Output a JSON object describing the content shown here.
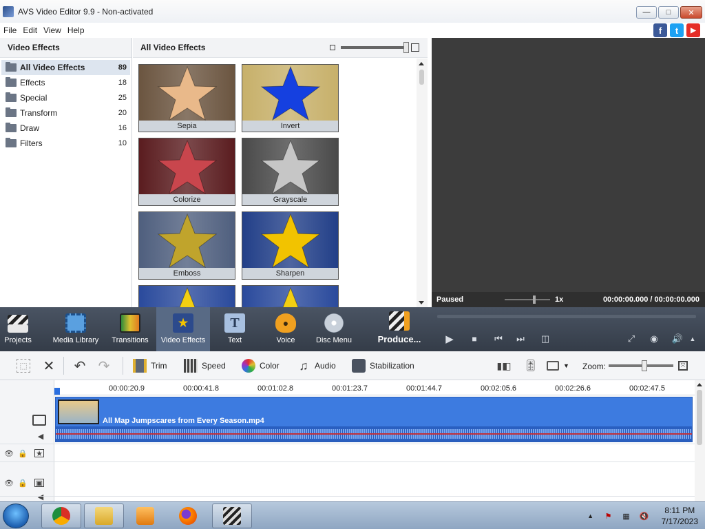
{
  "window": {
    "title": "AVS Video Editor 9.9 - Non-activated",
    "min_glyph": "—",
    "max_glyph": "□",
    "close_glyph": "✕"
  },
  "menu": [
    "File",
    "Edit",
    "View",
    "Help"
  ],
  "social": [
    {
      "name": "facebook",
      "glyph": "f",
      "color": "#3b5998"
    },
    {
      "name": "twitter",
      "glyph": "t",
      "color": "#1da1f2"
    },
    {
      "name": "youtube",
      "glyph": "▶",
      "color": "#e52d27"
    }
  ],
  "categories_panel": {
    "title": "Video Effects",
    "items": [
      {
        "label": "All Video Effects",
        "count": "89",
        "active": true
      },
      {
        "label": "Effects",
        "count": "18"
      },
      {
        "label": "Special",
        "count": "25"
      },
      {
        "label": "Transform",
        "count": "20"
      },
      {
        "label": "Draw",
        "count": "16"
      },
      {
        "label": "Filters",
        "count": "10"
      }
    ]
  },
  "effects_panel": {
    "title": "All Video Effects",
    "tiles": [
      {
        "label": "Sepia",
        "bg": "#6b5540",
        "star": "#e9b98a"
      },
      {
        "label": "Invert",
        "bg": "#c7b06a",
        "star": "#1540e0"
      },
      {
        "label": "Colorize",
        "bg": "#5a1c1f",
        "star": "#c9464d"
      },
      {
        "label": "Grayscale",
        "bg": "#4a4a4a",
        "star": "#c6c6c6"
      },
      {
        "label": "Emboss",
        "bg": "#4f5f7e",
        "star": "#c0a42c"
      },
      {
        "label": "Sharpen",
        "bg": "#223f88",
        "star": "#f2c300"
      },
      {
        "label": "",
        "bg": "#2a4a9c",
        "star": "#f3cf12"
      },
      {
        "label": "",
        "bg": "#2a4a9c",
        "star": "#f3cf12"
      }
    ]
  },
  "preview": {
    "status": "Paused",
    "speed": "1x",
    "time": "00:00:00.000 / 00:00:00.000"
  },
  "toolbar": [
    {
      "label": "Projects",
      "icon": "clapper-icon",
      "color": "#e8e8e8"
    },
    {
      "label": "Media Library",
      "icon": "film-icon",
      "color": "#5aa0e0"
    },
    {
      "label": "Transitions",
      "icon": "transition-icon",
      "color": "#e0b030"
    },
    {
      "label": "Video Effects",
      "icon": "star-icon",
      "color": "#2c4a8c",
      "active": true
    },
    {
      "label": "Text",
      "icon": "text-icon",
      "color": "#a8c0e0"
    },
    {
      "label": "Voice",
      "icon": "microphone-icon",
      "color": "#f0a020"
    },
    {
      "label": "Disc Menu",
      "icon": "disc-icon",
      "color": "#c8d0da"
    },
    {
      "label": "Produce...",
      "icon": "produce-icon",
      "color": "#e8e8e8"
    }
  ],
  "edit_toolbar": {
    "trim": "Trim",
    "speed": "Speed",
    "color": "Color",
    "audio": "Audio",
    "stabilization": "Stabilization",
    "zoom": "Zoom:"
  },
  "timeline": {
    "ticks": [
      "00:00:20.9",
      "00:00:41.8",
      "00:01:02.8",
      "00:01:23.7",
      "00:01:44.7",
      "00:02:05.6",
      "00:02:26.6",
      "00:02:47.5"
    ],
    "clip_name": "All Map Jumpscares from Every Season.mp4"
  },
  "taskbar": {
    "apps": [
      {
        "name": "chrome",
        "color": "#d93025",
        "open": true
      },
      {
        "name": "file-explorer",
        "color": "#e8c24a",
        "open": true
      },
      {
        "name": "media-player",
        "color": "#f0a030",
        "open": false
      },
      {
        "name": "firefox",
        "color": "#e66000",
        "open": false
      },
      {
        "name": "video-editor",
        "color": "#333333",
        "open": true
      }
    ],
    "time": "8:11 PM",
    "date": "7/17/2023"
  }
}
